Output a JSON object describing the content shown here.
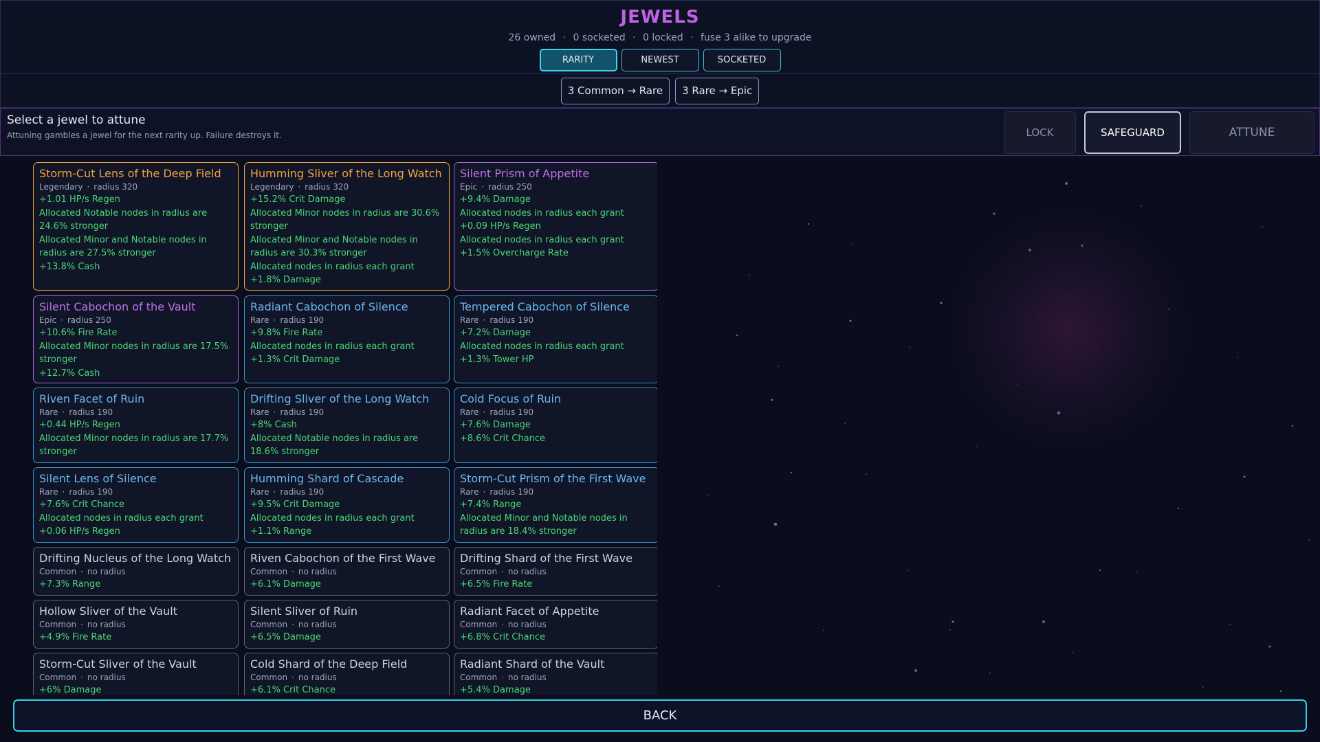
{
  "header": {
    "title": "JEWELS",
    "stats": [
      "26 owned",
      "0 socketed",
      "0 locked",
      "fuse 3 alike to upgrade"
    ],
    "separator": "·",
    "sort_tabs": [
      {
        "label": "RARITY",
        "active": true
      },
      {
        "label": "NEWEST",
        "active": false
      },
      {
        "label": "SOCKETED",
        "active": false
      }
    ]
  },
  "fuse": {
    "buttons": [
      "3 Common → Rare",
      "3 Rare → Epic"
    ]
  },
  "attune": {
    "title": "Select a jewel to attune",
    "description": "Attuning gambles a jewel for the next rarity up. Failure destroys it.",
    "lock_label": "LOCK",
    "safeguard_label": "SAFEGUARD",
    "attune_label": "ATTUNE"
  },
  "colors": {
    "legendary": "#f4a340",
    "epic": "#c070ea",
    "rare": "#6ab8f0",
    "common": "#d0d4e0",
    "stat": "#4cd674",
    "accent": "#3ad0ea"
  },
  "jewels": [
    {
      "name": "Storm-Cut Lens of the Deep Field",
      "rarity": "Legendary",
      "radius": "radius 320",
      "stats": [
        "+1.01 HP/s Regen",
        "Allocated Notable nodes in radius are 24.6% stronger",
        "Allocated Minor and Notable nodes in radius are 27.5% stronger",
        "+13.8% Cash"
      ]
    },
    {
      "name": "Humming Sliver of the Long Watch",
      "rarity": "Legendary",
      "radius": "radius 320",
      "stats": [
        "+15.2% Crit Damage",
        "Allocated Minor nodes in radius are 30.6% stronger",
        "Allocated Minor and Notable nodes in radius are 30.3% stronger",
        "Allocated nodes in radius each grant +1.8% Damage"
      ]
    },
    {
      "name": "Silent Prism of Appetite",
      "rarity": "Epic",
      "radius": "radius 250",
      "stats": [
        "+9.4% Damage",
        "Allocated nodes in radius each grant +0.09 HP/s Regen",
        "Allocated nodes in radius each grant +1.5% Overcharge Rate"
      ]
    },
    {
      "name": "Silent Cabochon of the Vault",
      "rarity": "Epic",
      "radius": "radius 250",
      "stats": [
        "+10.6% Fire Rate",
        "Allocated Minor nodes in radius are 17.5% stronger",
        "+12.7% Cash"
      ]
    },
    {
      "name": "Radiant Cabochon of Silence",
      "rarity": "Rare",
      "radius": "radius 190",
      "stats": [
        "+9.8% Fire Rate",
        "Allocated nodes in radius each grant +1.3% Crit Damage"
      ]
    },
    {
      "name": "Tempered Cabochon of Silence",
      "rarity": "Rare",
      "radius": "radius 190",
      "stats": [
        "+7.2% Damage",
        "Allocated nodes in radius each grant +1.3% Tower HP"
      ]
    },
    {
      "name": "Riven Facet of Ruin",
      "rarity": "Rare",
      "radius": "radius 190",
      "stats": [
        "+0.44 HP/s Regen",
        "Allocated Minor nodes in radius are 17.7% stronger"
      ]
    },
    {
      "name": "Drifting Sliver of the Long Watch",
      "rarity": "Rare",
      "radius": "radius 190",
      "stats": [
        "+8% Cash",
        "Allocated Notable nodes in radius are 18.6% stronger"
      ]
    },
    {
      "name": "Cold Focus of Ruin",
      "rarity": "Rare",
      "radius": "radius 190",
      "stats": [
        "+7.6% Damage",
        "+8.6% Crit Chance"
      ]
    },
    {
      "name": "Silent Lens of Silence",
      "rarity": "Rare",
      "radius": "radius 190",
      "stats": [
        "+7.6% Crit Chance",
        "Allocated nodes in radius each grant +0.06 HP/s Regen"
      ]
    },
    {
      "name": "Humming Shard of Cascade",
      "rarity": "Rare",
      "radius": "radius 190",
      "stats": [
        "+9.5% Crit Damage",
        "Allocated nodes in radius each grant +1.1% Range"
      ]
    },
    {
      "name": "Storm-Cut Prism of the First Wave",
      "rarity": "Rare",
      "radius": "radius 190",
      "stats": [
        "+7.4% Range",
        "Allocated Minor and Notable nodes in radius are 18.4% stronger"
      ]
    },
    {
      "name": "Drifting Nucleus of the Long Watch",
      "rarity": "Common",
      "radius": "no radius",
      "stats": [
        "+7.3% Range"
      ]
    },
    {
      "name": "Riven Cabochon of the First Wave",
      "rarity": "Common",
      "radius": "no radius",
      "stats": [
        "+6.1% Damage"
      ]
    },
    {
      "name": "Drifting Shard of the First Wave",
      "rarity": "Common",
      "radius": "no radius",
      "stats": [
        "+6.5% Fire Rate"
      ]
    },
    {
      "name": "Hollow Sliver of the Vault",
      "rarity": "Common",
      "radius": "no radius",
      "stats": [
        "+4.9% Fire Rate"
      ]
    },
    {
      "name": "Silent Sliver of Ruin",
      "rarity": "Common",
      "radius": "no radius",
      "stats": [
        "+6.5% Damage"
      ]
    },
    {
      "name": "Radiant Facet of Appetite",
      "rarity": "Common",
      "radius": "no radius",
      "stats": [
        "+6.8% Crit Chance"
      ]
    },
    {
      "name": "Storm-Cut Sliver of the Vault",
      "rarity": "Common",
      "radius": "no radius",
      "stats": [
        "+6% Damage"
      ]
    },
    {
      "name": "Cold Shard of the Deep Field",
      "rarity": "Common",
      "radius": "no radius",
      "stats": [
        "+6.1% Crit Chance"
      ]
    },
    {
      "name": "Radiant Shard of the Vault",
      "rarity": "Common",
      "radius": "no radius",
      "stats": [
        "+5.4% Damage"
      ]
    }
  ],
  "back_label": "BACK"
}
